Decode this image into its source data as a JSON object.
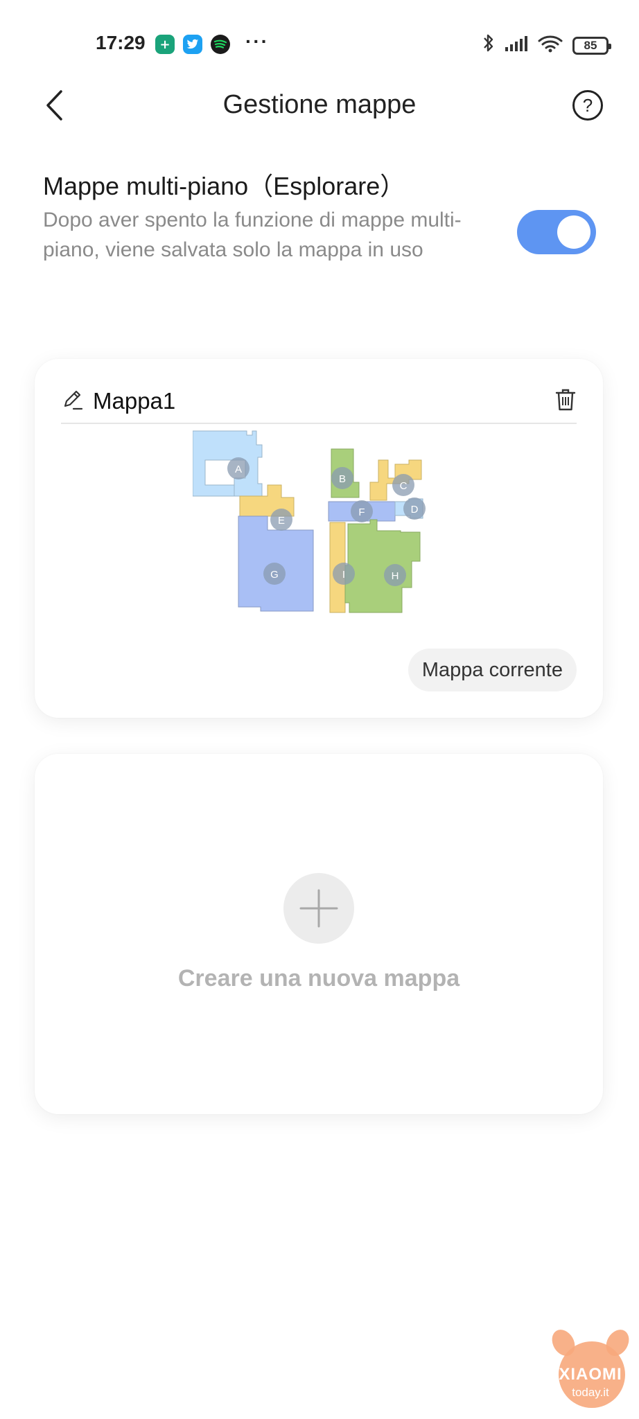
{
  "status_bar": {
    "time": "17:29",
    "more_indicator": "···",
    "battery_level": "85",
    "app_icons": [
      "green-app-icon",
      "twitter-icon",
      "spotify-icon"
    ],
    "right_icons": [
      "bluetooth-icon",
      "signal-icon",
      "wifi-icon",
      "battery-icon"
    ]
  },
  "header": {
    "title": "Gestione mappe",
    "help_label": "?"
  },
  "multi_floor": {
    "title": "Mappe multi-piano（Esplorare）",
    "description": "Dopo aver spento la funzione di mappe multi-piano, viene salvata solo la mappa in uso",
    "enabled": true
  },
  "map_card": {
    "name": "Mappa1",
    "rooms": [
      "A",
      "B",
      "C",
      "D",
      "E",
      "F",
      "G",
      "H",
      "I"
    ],
    "current_label": "Mappa corrente"
  },
  "new_map": {
    "label": "Creare una nuova mappa"
  },
  "watermark": {
    "brand": "XIAOMI",
    "site": "today.it"
  },
  "colors": {
    "accent_blue": "#5e95f2",
    "room_light_blue": "#bfe0fb",
    "room_yellow": "#f6d77f",
    "room_green": "#a9cf7b",
    "room_periwinkle": "#a9bff5"
  }
}
